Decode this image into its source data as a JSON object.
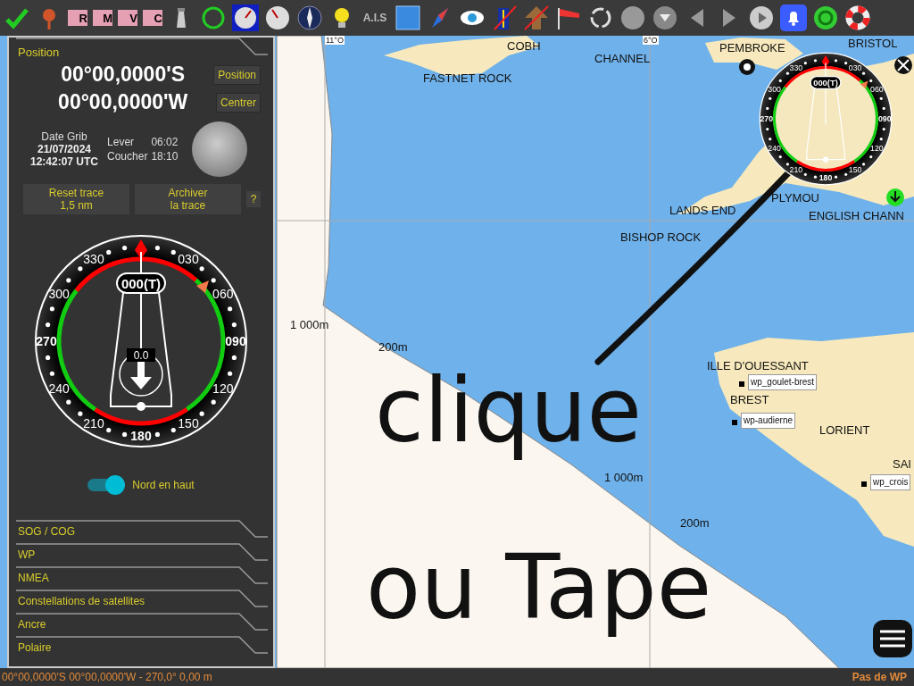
{
  "toolbar": {
    "chart_buttons": [
      "R",
      "M",
      "V",
      "C"
    ],
    "ais_label": "A.I.S",
    "bell_active": true
  },
  "panel": {
    "title": "Position",
    "latitude": "00°00,0000'S",
    "longitude": "00°00,0000'W",
    "position_button": "Position",
    "center_button": "Centrer",
    "grib_label": "Date Grib",
    "grib_date": "21/07/2024",
    "grib_time": "12:42:07 UTC",
    "rise_label": "Lever",
    "rise_time": "06:02",
    "set_label": "Coucher",
    "set_time": "18:10",
    "reset_button": [
      "Reset trace",
      "1,5 nm"
    ],
    "archive_button": [
      "Archiver",
      "la trace"
    ],
    "help_button": "?",
    "compass": {
      "heading": "000(T)",
      "speed": "0.0",
      "labels": [
        "030",
        "060",
        "090",
        "120",
        "150",
        "180",
        "210",
        "240",
        "270",
        "300",
        "330"
      ]
    },
    "north_up": {
      "label": "Nord en haut",
      "on": true
    },
    "sections": [
      "SOG / COG",
      "WP",
      "NMEA",
      "Constellations de satellites",
      "Ancre",
      "Polaire"
    ]
  },
  "map": {
    "labels": [
      {
        "text": "11°O",
        "kind": "grid"
      },
      {
        "text": "6°O",
        "kind": "grid"
      },
      {
        "text": "COBH",
        "kind": "place"
      },
      {
        "text": "CHANNEL",
        "kind": "place"
      },
      {
        "text": "FASTNET ROCK",
        "kind": "place"
      },
      {
        "text": "PEMBROKE",
        "kind": "place"
      },
      {
        "text": "BRISTOL",
        "kind": "place"
      },
      {
        "text": "PLYMOU",
        "kind": "place"
      },
      {
        "text": "ENGLISH CHANN",
        "kind": "place"
      },
      {
        "text": "LANDS END",
        "kind": "place"
      },
      {
        "text": "BISHOP ROCK",
        "kind": "place"
      },
      {
        "text": "1 000m",
        "kind": "depth"
      },
      {
        "text": "200m",
        "kind": "depth"
      },
      {
        "text": "ILLE D'OUESSANT",
        "kind": "place"
      },
      {
        "text": "wp_goulet-brest",
        "kind": "waypoint"
      },
      {
        "text": "BREST",
        "kind": "place"
      },
      {
        "text": "wp-audierne",
        "kind": "waypoint"
      },
      {
        "text": "LORIENT",
        "kind": "place"
      },
      {
        "text": "1 000m",
        "kind": "depth"
      },
      {
        "text": "200m",
        "kind": "depth"
      },
      {
        "text": "SAI",
        "kind": "place"
      },
      {
        "text": "wp_crois",
        "kind": "waypoint"
      }
    ],
    "mini_compass": {
      "heading": "000(T)",
      "labels": [
        "030",
        "060",
        "090",
        "120",
        "150",
        "180",
        "210",
        "240",
        "270",
        "300",
        "330"
      ]
    },
    "annotation": [
      "clique",
      "ou Tape"
    ]
  },
  "status_bar": {
    "position": "00°00,0000'S 00°00,0000'W - 270,0° 0,00 m",
    "waypoint": "Pas de WP"
  }
}
